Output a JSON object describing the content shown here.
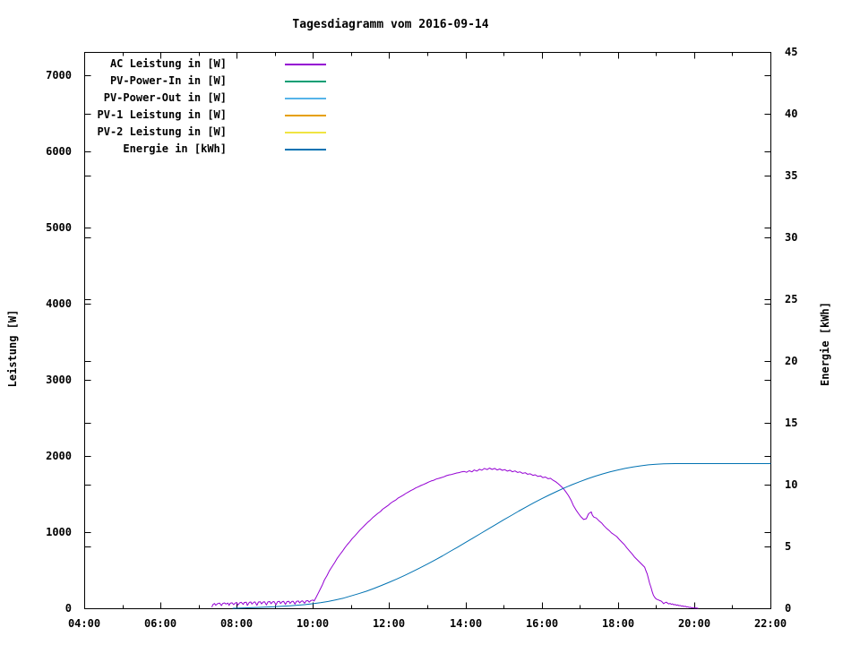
{
  "chart_data": {
    "type": "line",
    "title": "Tagesdiagramm vom 2016-09-14",
    "xlabel": "",
    "ylabel_left": "Leistung [W]",
    "ylabel_right": "Energie [kWh]",
    "x_range_hours": [
      4,
      22
    ],
    "x_major_hours": [
      4,
      6,
      8,
      10,
      12,
      14,
      16,
      18,
      20,
      22
    ],
    "x_major_labels": [
      "04:00",
      "06:00",
      "08:00",
      "10:00",
      "12:00",
      "14:00",
      "16:00",
      "18:00",
      "20:00",
      "22:00"
    ],
    "x_minor_hours": [
      5,
      7,
      9,
      11,
      13,
      15,
      17,
      19,
      21
    ],
    "ylim_left": [
      0,
      7300
    ],
    "y_left_tick_values": [
      0,
      1000,
      2000,
      3000,
      4000,
      5000,
      6000,
      7000
    ],
    "y_left_tick_labels": [
      "0",
      "1000",
      "2000",
      "3000",
      "4000",
      "5000",
      "6000",
      "7000"
    ],
    "ylim_right": [
      0,
      45
    ],
    "y_right_tick_values": [
      0,
      5,
      10,
      15,
      20,
      25,
      30,
      35,
      40,
      45
    ],
    "y_right_tick_labels": [
      "0",
      "5",
      "10",
      "15",
      "20",
      "25",
      "30",
      "35",
      "40",
      "45"
    ],
    "grid": false,
    "legend_position": "top-left-inside",
    "legend": [
      {
        "label": "AC Leistung in [W]",
        "color": "#9400d3"
      },
      {
        "label": "PV-Power-In in [W]",
        "color": "#009e73"
      },
      {
        "label": "PV-Power-Out in [W]",
        "color": "#56b4e9"
      },
      {
        "label": "PV-1 Leistung in [W]",
        "color": "#e69f00"
      },
      {
        "label": "PV-2 Leistung in [W]",
        "color": "#f0e442"
      },
      {
        "label": "Energie in [kWh]",
        "color": "#0072b2"
      }
    ],
    "series": [
      {
        "name": "AC Leistung in [W]",
        "color": "#9400d3",
        "axis": "left",
        "points": [
          [
            7.35,
            20
          ],
          [
            7.38,
            50
          ],
          [
            7.42,
            62
          ],
          [
            7.45,
            40
          ],
          [
            7.5,
            60
          ],
          [
            7.55,
            68
          ],
          [
            7.6,
            35
          ],
          [
            7.63,
            62
          ],
          [
            7.68,
            70
          ],
          [
            7.72,
            55
          ],
          [
            7.77,
            68
          ],
          [
            7.8,
            38
          ],
          [
            7.83,
            66
          ],
          [
            7.88,
            72
          ],
          [
            7.92,
            48
          ],
          [
            7.97,
            70
          ],
          [
            8.0,
            75
          ],
          [
            8.03,
            42
          ],
          [
            8.08,
            72
          ],
          [
            8.12,
            78
          ],
          [
            8.17,
            50
          ],
          [
            8.2,
            76
          ],
          [
            8.25,
            80
          ],
          [
            8.28,
            36
          ],
          [
            8.33,
            78
          ],
          [
            8.37,
            82
          ],
          [
            8.4,
            55
          ],
          [
            8.45,
            80
          ],
          [
            8.48,
            84
          ],
          [
            8.53,
            40
          ],
          [
            8.57,
            82
          ],
          [
            8.62,
            85
          ],
          [
            8.65,
            58
          ],
          [
            8.7,
            84
          ],
          [
            8.73,
            86
          ],
          [
            8.78,
            44
          ],
          [
            8.82,
            84
          ],
          [
            8.87,
            88
          ],
          [
            8.9,
            60
          ],
          [
            8.95,
            86
          ],
          [
            8.98,
            88
          ],
          [
            9.03,
            46
          ],
          [
            9.07,
            86
          ],
          [
            9.12,
            90
          ],
          [
            9.15,
            62
          ],
          [
            9.2,
            88
          ],
          [
            9.23,
            90
          ],
          [
            9.28,
            50
          ],
          [
            9.32,
            88
          ],
          [
            9.37,
            92
          ],
          [
            9.4,
            64
          ],
          [
            9.45,
            90
          ],
          [
            9.48,
            92
          ],
          [
            9.53,
            55
          ],
          [
            9.57,
            92
          ],
          [
            9.62,
            95
          ],
          [
            9.65,
            70
          ],
          [
            9.7,
            94
          ],
          [
            9.73,
            96
          ],
          [
            9.78,
            66
          ],
          [
            9.82,
            96
          ],
          [
            9.87,
            100
          ],
          [
            9.9,
            80
          ],
          [
            9.95,
            102
          ],
          [
            10.0,
            108
          ],
          [
            10.03,
            95
          ],
          [
            10.08,
            140
          ],
          [
            10.13,
            190
          ],
          [
            10.18,
            240
          ],
          [
            10.25,
            310
          ],
          [
            10.3,
            370
          ],
          [
            10.37,
            430
          ],
          [
            10.43,
            490
          ],
          [
            10.5,
            545
          ],
          [
            10.57,
            600
          ],
          [
            10.63,
            650
          ],
          [
            10.7,
            700
          ],
          [
            10.77,
            745
          ],
          [
            10.83,
            790
          ],
          [
            10.9,
            835
          ],
          [
            10.97,
            875
          ],
          [
            11.03,
            915
          ],
          [
            11.1,
            950
          ],
          [
            11.17,
            990
          ],
          [
            11.23,
            1025
          ],
          [
            11.3,
            1060
          ],
          [
            11.37,
            1095
          ],
          [
            11.43,
            1125
          ],
          [
            11.5,
            1155
          ],
          [
            11.57,
            1190
          ],
          [
            11.63,
            1215
          ],
          [
            11.7,
            1245
          ],
          [
            11.77,
            1270
          ],
          [
            11.83,
            1300
          ],
          [
            11.9,
            1325
          ],
          [
            11.97,
            1350
          ],
          [
            12.03,
            1375
          ],
          [
            12.1,
            1400
          ],
          [
            12.17,
            1420
          ],
          [
            12.23,
            1445
          ],
          [
            12.3,
            1465
          ],
          [
            12.37,
            1485
          ],
          [
            12.43,
            1505
          ],
          [
            12.5,
            1525
          ],
          [
            12.57,
            1545
          ],
          [
            12.63,
            1560
          ],
          [
            12.7,
            1580
          ],
          [
            12.77,
            1595
          ],
          [
            12.83,
            1610
          ],
          [
            12.9,
            1625
          ],
          [
            12.97,
            1640
          ],
          [
            13.03,
            1655
          ],
          [
            13.1,
            1670
          ],
          [
            13.17,
            1680
          ],
          [
            13.23,
            1695
          ],
          [
            13.3,
            1705
          ],
          [
            13.37,
            1715
          ],
          [
            13.43,
            1725
          ],
          [
            13.5,
            1740
          ],
          [
            13.57,
            1750
          ],
          [
            13.63,
            1755
          ],
          [
            13.7,
            1765
          ],
          [
            13.77,
            1775
          ],
          [
            13.83,
            1780
          ],
          [
            13.9,
            1790
          ],
          [
            13.97,
            1795
          ],
          [
            14.03,
            1785
          ],
          [
            14.1,
            1805
          ],
          [
            14.17,
            1790
          ],
          [
            14.23,
            1815
          ],
          [
            14.3,
            1800
          ],
          [
            14.37,
            1825
          ],
          [
            14.43,
            1812
          ],
          [
            14.5,
            1835
          ],
          [
            14.57,
            1820
          ],
          [
            14.63,
            1840
          ],
          [
            14.7,
            1822
          ],
          [
            14.77,
            1835
          ],
          [
            14.83,
            1815
          ],
          [
            14.9,
            1828
          ],
          [
            14.97,
            1810
          ],
          [
            15.03,
            1820
          ],
          [
            15.1,
            1800
          ],
          [
            15.17,
            1812
          ],
          [
            15.23,
            1792
          ],
          [
            15.3,
            1802
          ],
          [
            15.37,
            1782
          ],
          [
            15.43,
            1790
          ],
          [
            15.5,
            1770
          ],
          [
            15.57,
            1778
          ],
          [
            15.63,
            1758
          ],
          [
            15.7,
            1765
          ],
          [
            15.77,
            1745
          ],
          [
            15.83,
            1752
          ],
          [
            15.9,
            1730
          ],
          [
            15.97,
            1738
          ],
          [
            16.03,
            1715
          ],
          [
            16.1,
            1722
          ],
          [
            16.17,
            1700
          ],
          [
            16.23,
            1706
          ],
          [
            16.3,
            1680
          ],
          [
            16.37,
            1660
          ],
          [
            16.43,
            1635
          ],
          [
            16.5,
            1605
          ],
          [
            16.57,
            1570
          ],
          [
            16.63,
            1530
          ],
          [
            16.7,
            1480
          ],
          [
            16.77,
            1420
          ],
          [
            16.83,
            1350
          ],
          [
            16.9,
            1290
          ],
          [
            16.97,
            1240
          ],
          [
            17.03,
            1200
          ],
          [
            17.1,
            1165
          ],
          [
            17.17,
            1175
          ],
          [
            17.23,
            1240
          ],
          [
            17.3,
            1265
          ],
          [
            17.33,
            1220
          ],
          [
            17.37,
            1195
          ],
          [
            17.43,
            1185
          ],
          [
            17.5,
            1150
          ],
          [
            17.57,
            1120
          ],
          [
            17.63,
            1085
          ],
          [
            17.7,
            1050
          ],
          [
            17.77,
            1020
          ],
          [
            17.83,
            990
          ],
          [
            17.9,
            965
          ],
          [
            17.97,
            940
          ],
          [
            18.03,
            905
          ],
          [
            18.1,
            870
          ],
          [
            18.17,
            835
          ],
          [
            18.23,
            795
          ],
          [
            18.3,
            755
          ],
          [
            18.37,
            715
          ],
          [
            18.43,
            675
          ],
          [
            18.5,
            640
          ],
          [
            18.57,
            605
          ],
          [
            18.63,
            575
          ],
          [
            18.7,
            540
          ],
          [
            18.73,
            500
          ],
          [
            18.77,
            450
          ],
          [
            18.8,
            390
          ],
          [
            18.83,
            330
          ],
          [
            18.87,
            270
          ],
          [
            18.9,
            215
          ],
          [
            18.93,
            170
          ],
          [
            18.97,
            140
          ],
          [
            19.0,
            125
          ],
          [
            19.03,
            115
          ],
          [
            19.07,
            108
          ],
          [
            19.1,
            100
          ],
          [
            19.13,
            95
          ],
          [
            19.17,
            78
          ],
          [
            19.2,
            60
          ],
          [
            19.23,
            72
          ],
          [
            19.27,
            80
          ],
          [
            19.3,
            68
          ],
          [
            19.33,
            58
          ],
          [
            19.37,
            64
          ],
          [
            19.4,
            52
          ],
          [
            19.43,
            58
          ],
          [
            19.47,
            45
          ],
          [
            19.5,
            50
          ],
          [
            19.53,
            40
          ],
          [
            19.57,
            44
          ],
          [
            19.6,
            34
          ],
          [
            19.63,
            38
          ],
          [
            19.67,
            28
          ],
          [
            19.7,
            32
          ],
          [
            19.73,
            22
          ],
          [
            19.77,
            26
          ],
          [
            19.8,
            16
          ],
          [
            19.83,
            20
          ],
          [
            19.87,
            10
          ],
          [
            19.9,
            14
          ],
          [
            19.93,
            6
          ],
          [
            19.97,
            8
          ],
          [
            20.0,
            3
          ],
          [
            20.05,
            5
          ],
          [
            20.1,
            0
          ]
        ]
      },
      {
        "name": "Energie in [kWh]",
        "color": "#0072b2",
        "axis": "right",
        "points": [
          [
            7.9,
            0
          ],
          [
            8.2,
            0.03
          ],
          [
            8.6,
            0.07
          ],
          [
            9.0,
            0.12
          ],
          [
            9.4,
            0.2
          ],
          [
            9.8,
            0.3
          ],
          [
            10.0,
            0.37
          ],
          [
            10.2,
            0.45
          ],
          [
            10.4,
            0.55
          ],
          [
            10.6,
            0.68
          ],
          [
            10.8,
            0.82
          ],
          [
            11.0,
            1.0
          ],
          [
            11.2,
            1.18
          ],
          [
            11.4,
            1.38
          ],
          [
            11.6,
            1.6
          ],
          [
            11.8,
            1.85
          ],
          [
            12.0,
            2.1
          ],
          [
            12.2,
            2.37
          ],
          [
            12.4,
            2.65
          ],
          [
            12.6,
            2.95
          ],
          [
            12.8,
            3.25
          ],
          [
            13.0,
            3.57
          ],
          [
            13.2,
            3.9
          ],
          [
            13.4,
            4.24
          ],
          [
            13.6,
            4.6
          ],
          [
            13.8,
            4.95
          ],
          [
            14.0,
            5.32
          ],
          [
            14.2,
            5.68
          ],
          [
            14.4,
            6.05
          ],
          [
            14.6,
            6.42
          ],
          [
            14.8,
            6.78
          ],
          [
            15.0,
            7.15
          ],
          [
            15.2,
            7.5
          ],
          [
            15.4,
            7.86
          ],
          [
            15.6,
            8.2
          ],
          [
            15.8,
            8.54
          ],
          [
            16.0,
            8.86
          ],
          [
            16.2,
            9.17
          ],
          [
            16.4,
            9.46
          ],
          [
            16.6,
            9.74
          ],
          [
            16.8,
            10.0
          ],
          [
            17.0,
            10.24
          ],
          [
            17.2,
            10.47
          ],
          [
            17.4,
            10.68
          ],
          [
            17.6,
            10.87
          ],
          [
            17.8,
            11.04
          ],
          [
            18.0,
            11.19
          ],
          [
            18.2,
            11.32
          ],
          [
            18.4,
            11.43
          ],
          [
            18.6,
            11.52
          ],
          [
            18.8,
            11.6
          ],
          [
            19.0,
            11.65
          ],
          [
            19.2,
            11.68
          ],
          [
            19.5,
            11.7
          ],
          [
            20.0,
            11.7
          ],
          [
            21.0,
            11.7
          ],
          [
            22.0,
            11.7
          ]
        ]
      }
    ]
  }
}
